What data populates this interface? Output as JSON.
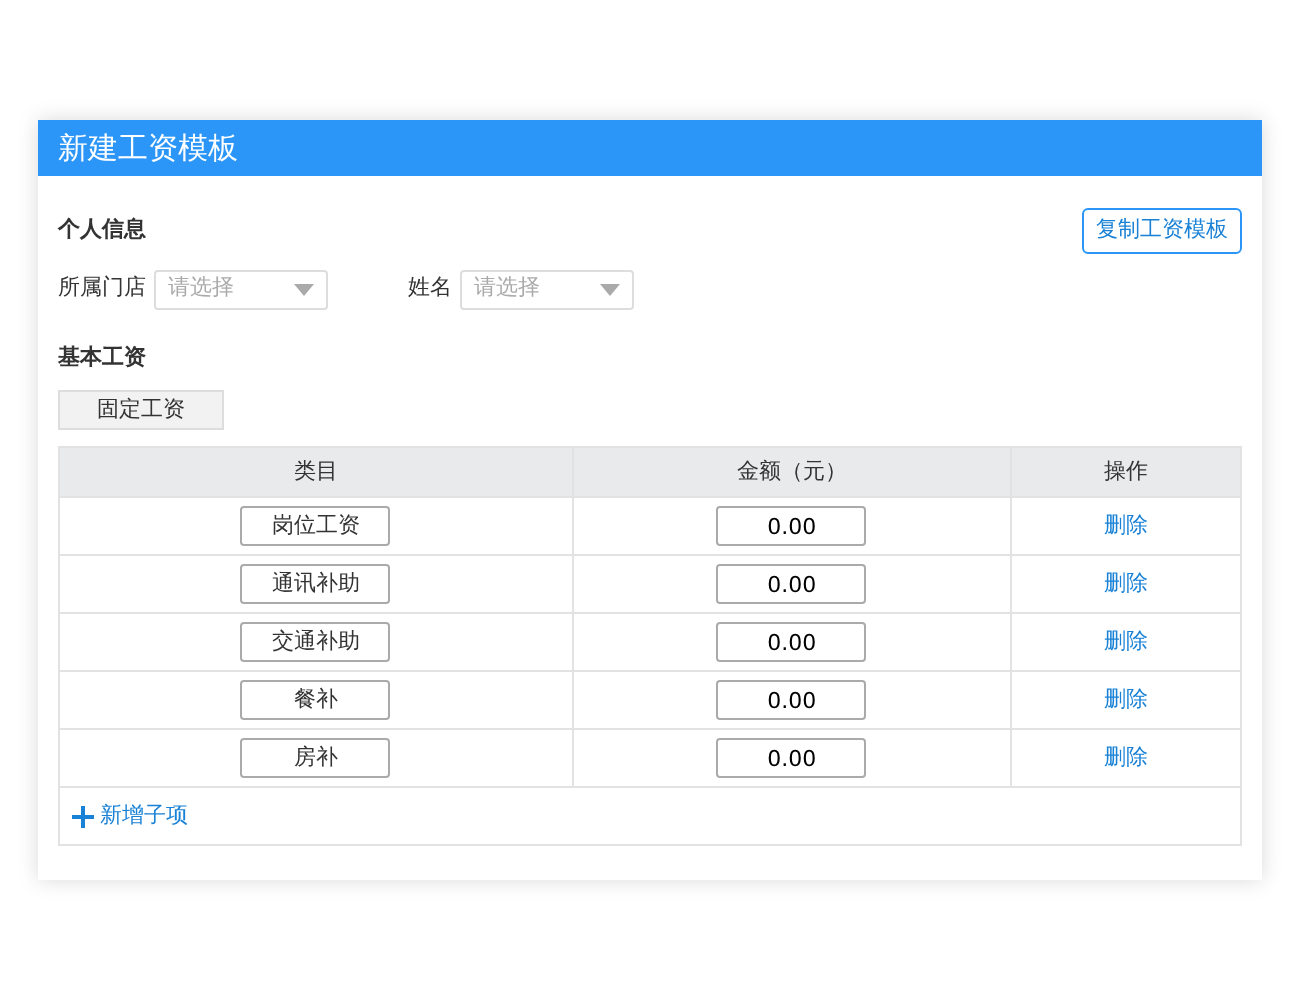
{
  "dialog": {
    "title": "新建工资模板"
  },
  "personal_info": {
    "heading": "个人信息",
    "copy_button": "复制工资模板",
    "fields": [
      {
        "label": "所属门店",
        "placeholder": "请选择"
      },
      {
        "label": "姓名",
        "placeholder": "请选择"
      }
    ]
  },
  "basic_salary": {
    "heading": "基本工资",
    "type_button": "固定工资"
  },
  "table": {
    "columns": [
      "类目",
      "金额（元）",
      "操作"
    ],
    "rows": [
      {
        "item": "岗位工资",
        "amount": "0.00",
        "action": "删除"
      },
      {
        "item": "通讯补助",
        "amount": "0.00",
        "action": "删除"
      },
      {
        "item": "交通补助",
        "amount": "0.00",
        "action": "删除"
      },
      {
        "item": "餐补",
        "amount": "0.00",
        "action": "删除"
      },
      {
        "item": "房补",
        "amount": "0.00",
        "action": "删除"
      }
    ],
    "add_link": "新增子项"
  }
}
